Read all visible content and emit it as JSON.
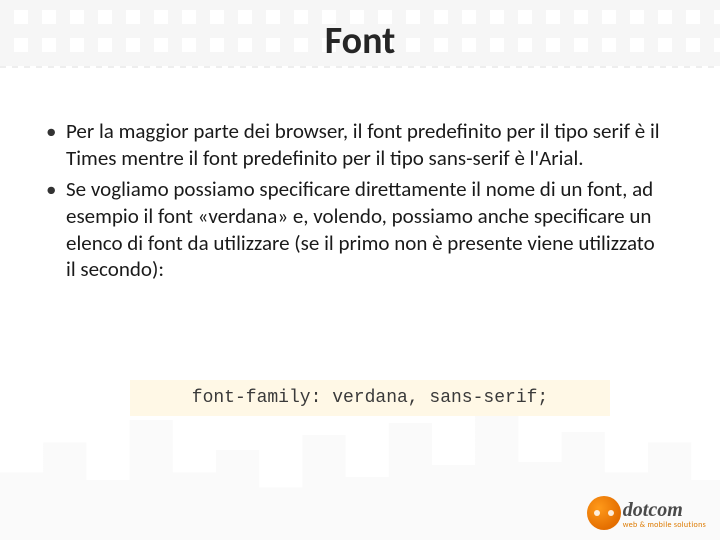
{
  "title": "Font",
  "bullets": [
    "Per la maggior parte dei browser, il font predefinito per il tipo serif è il Times mentre il font predefinito per il tipo sans-serif è l'Arial.",
    "Se vogliamo possiamo specificare direttamente il nome di un font, ad esempio il font «verdana» e, volendo, possiamo anche specificare un elenco di font da utilizzare (se il primo non è presente viene utilizzato il secondo):"
  ],
  "code": "font-family: verdana, sans-serif;",
  "logo": {
    "brand": "dotcom",
    "tagline": "web & mobile solutions"
  }
}
